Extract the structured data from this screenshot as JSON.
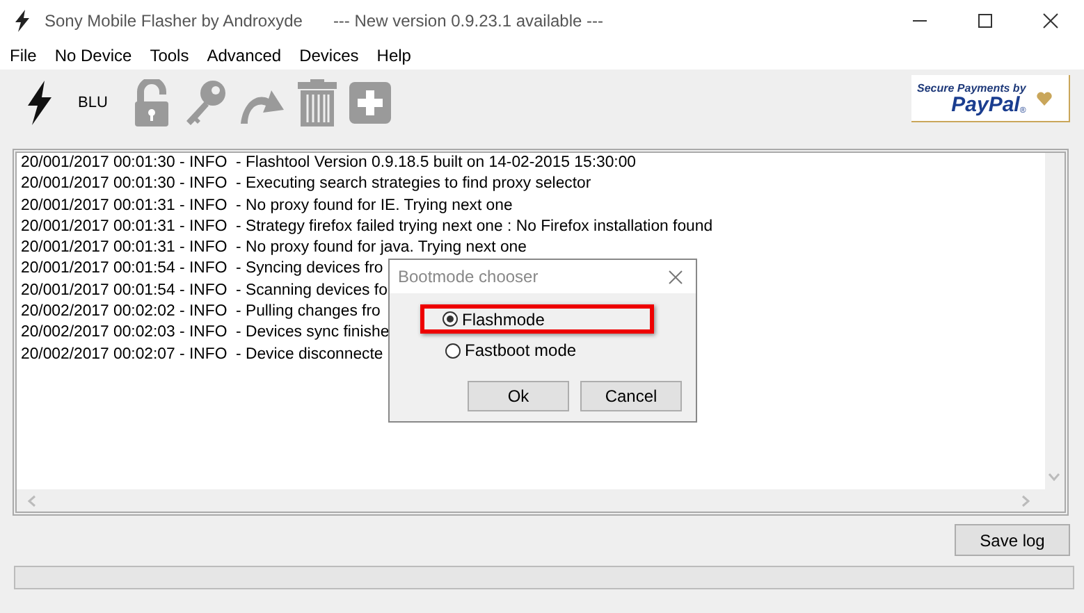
{
  "window": {
    "title": "Sony Mobile Flasher by Androxyde",
    "notice": "--- New version 0.9.23.1 available ---"
  },
  "menu": [
    "File",
    "No Device",
    "Tools",
    "Advanced",
    "Devices",
    "Help"
  ],
  "toolbar": {
    "device_label": "BLU",
    "items": [
      {
        "kind": "flash",
        "disabled": false
      },
      {
        "kind": "unlock",
        "disabled": true
      },
      {
        "kind": "key",
        "disabled": true
      },
      {
        "kind": "redo",
        "disabled": true
      },
      {
        "kind": "trash",
        "disabled": true
      },
      {
        "kind": "add",
        "disabled": true
      }
    ],
    "donate": {
      "caption": "Secure Payments by",
      "brand": "PayPal",
      "mark": "®"
    }
  },
  "log": [
    "20/001/2017 00:01:30 - INFO  - Flashtool Version 0.9.18.5 built on 14-02-2015 15:30:00",
    "20/001/2017 00:01:30 - INFO  - Executing search strategies to find proxy selector",
    "20/001/2017 00:01:31 - INFO  - No proxy found for IE. Trying next one",
    "20/001/2017 00:01:31 - INFO  - Strategy firefox failed trying next one : No Firefox installation found",
    "20/001/2017 00:01:31 - INFO  - No proxy found for java. Trying next one",
    "20/001/2017 00:01:54 - INFO  - Syncing devices fro",
    "20/001/2017 00:01:54 - INFO  - Scanning devices fo",
    "20/002/2017 00:02:02 - INFO  - Pulling changes fro",
    "20/002/2017 00:02:03 - INFO  - Devices sync finishe",
    "20/002/2017 00:02:07 - INFO  - Device disconnecte"
  ],
  "save_button": "Save log",
  "dialog": {
    "title": "Bootmode chooser",
    "options": [
      {
        "label": "Flashmode",
        "selected": true,
        "highlighted": true
      },
      {
        "label": "Fastboot mode",
        "selected": false,
        "highlighted": false
      }
    ],
    "buttons": [
      "Ok",
      "Cancel"
    ]
  }
}
